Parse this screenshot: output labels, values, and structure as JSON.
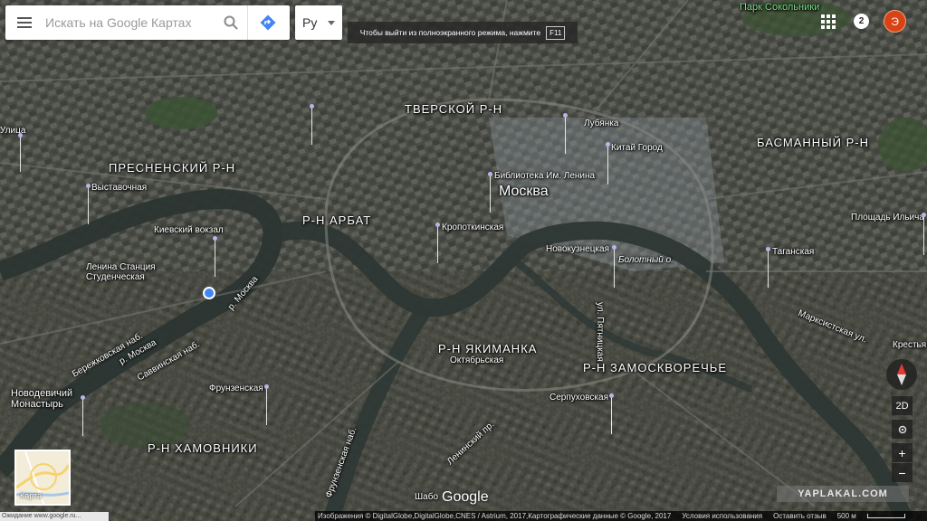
{
  "search": {
    "placeholder": "Искать на Google Картах"
  },
  "language": {
    "selected": "Ру"
  },
  "fullscreen_banner": {
    "text": "Чтобы выйти из полноэкранного режима, нажмите",
    "key": "F11"
  },
  "account": {
    "notifications": "2",
    "avatar_letter": "Э"
  },
  "map": {
    "districts": [
      "ТВЕРСКОЙ Р-Н",
      "ПРЕСНЕНСКИЙ Р-Н",
      "БАСМАННЫЙ Р-Н",
      "Р-Н АРБАТ",
      "Р-Н ЯКИМАНКА",
      "Р-Н ЗАМОСКВОРЕЧЬЕ",
      "Р-Н ХАМОВНИКИ"
    ],
    "city": "Москва",
    "park": "Парк Сокольники",
    "places": [
      "Лубянка",
      "Китай Город",
      "Библиотека Им. Ленина",
      "Кропоткинская",
      "Новокузнецкая",
      "Болотный о.",
      "Выставочная",
      "Киевский вокзал",
      "Ленина Станция Студенческая",
      "Площадь Ильича",
      "Таганская",
      "Марксистская ул.",
      "Крестья",
      "Октябрьская",
      "Серпуховская",
      "Фрунзенская",
      "Новодевичий Монастырь",
      "Улица",
      "Шабо"
    ],
    "streets": [
      "Бережковская наб.",
      "р. Москва",
      "Саввинская наб.",
      "р. Москва",
      "ул. Пятницкая",
      "Ленинский пр.",
      "Фрунзенская наб."
    ]
  },
  "minimap": {
    "label": "Карта"
  },
  "controls": {
    "mode": "2D",
    "zoom_in": "+",
    "zoom_out": "−"
  },
  "footer": {
    "attribution": "Изображения © DigitalGlobe,DigitalGlobe,CNES / Astrium, 2017,Картографические данные © Google, 2017",
    "terms": "Условия использования",
    "feedback": "Оставить отзыв",
    "scale": "500 м"
  },
  "status_url": "Ожидание www.google.ru...",
  "logo": "Google",
  "watermark": "YAPLAKAL.COM"
}
